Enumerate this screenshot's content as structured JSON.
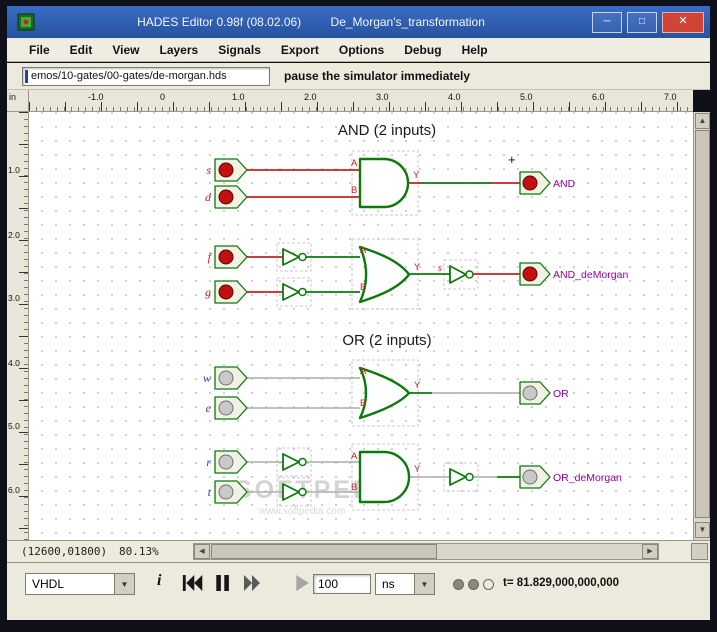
{
  "window": {
    "title": "HADES Editor 0.98f (08.02.06)",
    "subtitle": "De_Morgan's_transformation",
    "minimize": "─",
    "maximize": "□",
    "close": "✕"
  },
  "menu": [
    "File",
    "Edit",
    "View",
    "Layers",
    "Signals",
    "Export",
    "Options",
    "Debug",
    "Help"
  ],
  "toolbar": {
    "path": "emos/10-gates/00-gates/de-morgan.hds",
    "hint": "pause the simulator immediately"
  },
  "ruler": {
    "unit": "in",
    "h": [
      "-1.0",
      "0",
      "1.0",
      "2.0",
      "3.0",
      "4.0",
      "5.0",
      "6.0",
      "7.0"
    ],
    "v": [
      "1.0",
      "2.0",
      "3.0",
      "4.0",
      "5.0",
      "6.0"
    ]
  },
  "circuit": {
    "and_title": "AND (2 inputs)",
    "or_title": "OR (2 inputs)",
    "plus": "+",
    "ports": {
      "a": "A",
      "b": "B",
      "y": "Y"
    },
    "mid_label": "s",
    "and": {
      "in1": "s",
      "in2": "d",
      "out": "AND"
    },
    "and_dm": {
      "in1": "f",
      "in2": "g",
      "out": "AND_deMorgan"
    },
    "or": {
      "in1": "w",
      "in2": "e",
      "out": "OR"
    },
    "or_dm": {
      "in1": "r",
      "in2": "t",
      "out": "OR_deMorgan"
    }
  },
  "watermark": {
    "title": "SOFTPEDIA",
    "url": "www.softpedia.com"
  },
  "status": {
    "coords": "(12600,01800)",
    "zoom": "80.13%"
  },
  "controls": {
    "mode": "VHDL",
    "info": "i",
    "time_value": "100",
    "unit": "ns",
    "time": "t= 81.829,000,000,000"
  },
  "icons": {
    "dropdown": "▼",
    "arrow_up": "▲",
    "arrow_down": "▼",
    "arrow_left": "◀",
    "arrow_right": "▶"
  },
  "colors": {
    "titlebar": "#2f5cb0",
    "close_button": "#cf4638",
    "gate_green": "#0a7a0a",
    "wire_active": "#c42323",
    "wire_inactive": "#b4b8b4",
    "output_label": "#990099",
    "led_on": "#2bd42b",
    "chrome": "#ece9dd"
  }
}
